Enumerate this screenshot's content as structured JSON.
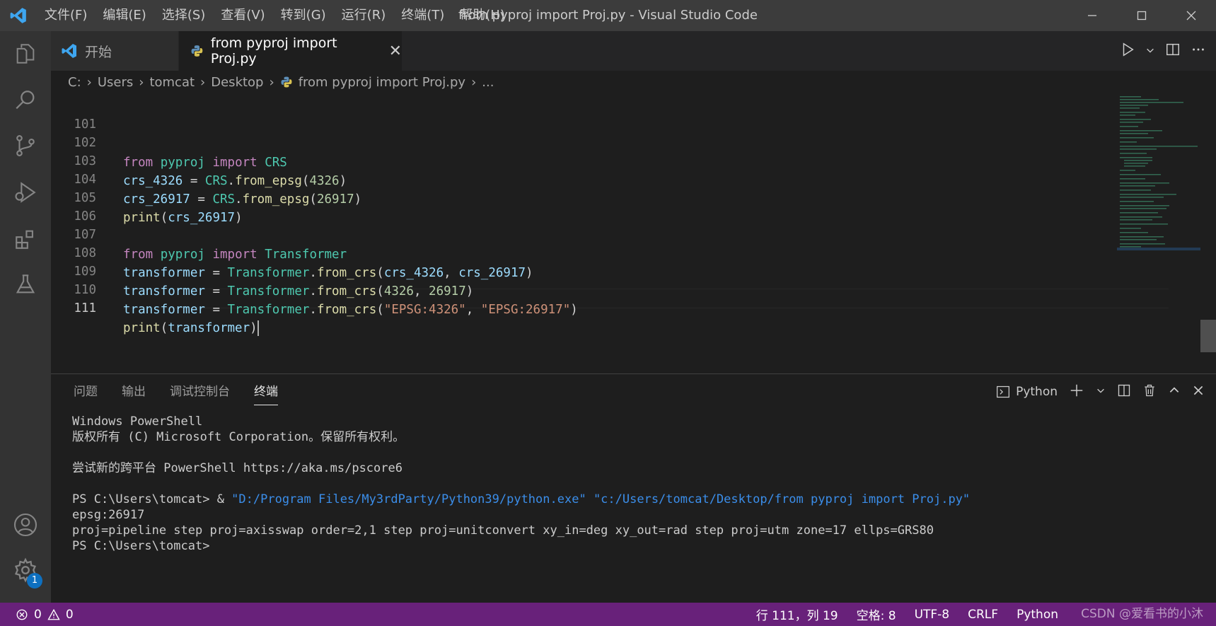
{
  "titlebar": {
    "menu": [
      "文件(F)",
      "编辑(E)",
      "选择(S)",
      "查看(V)",
      "转到(G)",
      "运行(R)",
      "终端(T)",
      "帮助(H)"
    ],
    "title": "from pyproj import Proj.py - Visual Studio Code"
  },
  "tabs": [
    {
      "label": "开始",
      "icon": "vscode-logo-icon"
    },
    {
      "label": "from pyproj import Proj.py",
      "icon": "python-file-icon",
      "close": "✕"
    }
  ],
  "breadcrumb": [
    "C:",
    "Users",
    "tomcat",
    "Desktop",
    "from pyproj import Proj.py",
    "..."
  ],
  "editor": {
    "line_numbers": [
      "101",
      "102",
      "103",
      "104",
      "105",
      "106",
      "107",
      "108",
      "109",
      "110",
      "111"
    ],
    "l102": [
      "from",
      "pyproj",
      "import",
      "CRS"
    ],
    "l103": [
      "crs_4326",
      " = ",
      "CRS",
      ".",
      "from_epsg",
      "(",
      "4326",
      ")"
    ],
    "l104": [
      "crs_26917",
      " = ",
      "CRS",
      ".",
      "from_epsg",
      "(",
      "26917",
      ")"
    ],
    "l105": [
      "print",
      "(",
      "crs_26917",
      ")"
    ],
    "l107": [
      "from",
      "pyproj",
      "import",
      "Transformer"
    ],
    "l108": [
      "transformer",
      " = ",
      "Transformer",
      ".",
      "from_crs",
      "(",
      "crs_4326",
      ", ",
      "crs_26917",
      ")"
    ],
    "l109": [
      "transformer",
      " = ",
      "Transformer",
      ".",
      "from_crs",
      "(",
      "4326",
      ", ",
      "26917",
      ")"
    ],
    "l110": [
      "transformer",
      " = ",
      "Transformer",
      ".",
      "from_crs",
      "(",
      "\"EPSG:4326\"",
      ", ",
      "\"EPSG:26917\"",
      ")"
    ],
    "l111": [
      "print",
      "(",
      "transformer",
      ")"
    ]
  },
  "panel": {
    "tabs": [
      "问题",
      "输出",
      "调试控制台",
      "终端"
    ],
    "shell": "Python"
  },
  "terminal": {
    "l1": "Windows PowerShell",
    "l2": "版权所有 (C) Microsoft Corporation。保留所有权利。",
    "l3": "尝试新的跨平台 PowerShell https://aka.ms/pscore6",
    "l4_prompt": "PS C:\\Users\\tomcat> & ",
    "l4_exe": "\"D:/Program Files/My3rdParty/Python39/python.exe\"",
    "l4_space": " ",
    "l4_file": "\"c:/Users/tomcat/Desktop/from pyproj import Proj.py\"",
    "l5": "epsg:26917",
    "l6": "proj=pipeline step proj=axisswap order=2,1 step proj=unitconvert xy_in=deg xy_out=rad step proj=utm zone=17 ellps=GRS80",
    "l7": "PS C:\\Users\\tomcat>"
  },
  "statusbar": {
    "errors": "0",
    "warnings": "0",
    "position": "行 111，列 19",
    "spaces": "空格: 8",
    "encoding": "UTF-8",
    "eol": "CRLF",
    "language": "Python",
    "watermark": "CSDN @爱看书的小沐"
  },
  "activity": {
    "settings_badge": "1"
  },
  "colors": {
    "statusbar": "#68217a",
    "accent": "#0e70c0",
    "keyword": "#c586c0",
    "class": "#4ec9b0",
    "string": "#ce9178",
    "number": "#b5cea8"
  }
}
